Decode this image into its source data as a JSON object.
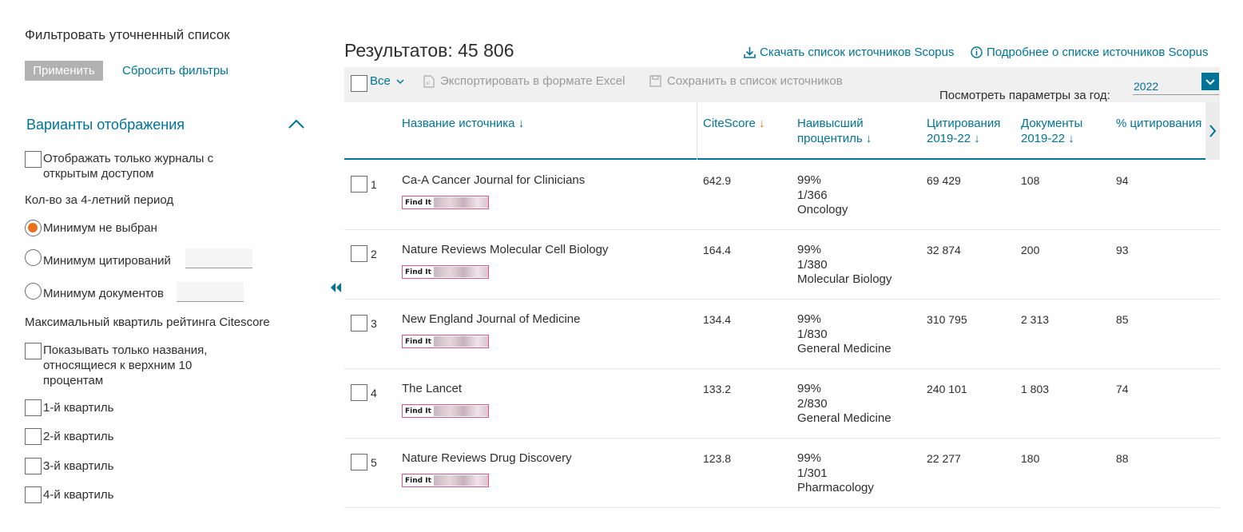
{
  "sidebar": {
    "title": "Фильтровать уточненный список",
    "apply_label": "Применить",
    "reset_label": "Сбросить фильтры",
    "display_options": "Варианты отображения",
    "open_access_label_1": "Отображать только журналы с",
    "open_access_label_2": "открытым доступом",
    "period_label": "Кол-во за 4-летний период",
    "min_not_selected": "Минимум не выбран",
    "min_citations": "Минимум цитирований",
    "min_documents": "Минимум документов",
    "quartile_heading": "Максимальный квартиль рейтинга Citescore",
    "top10_line1": "Показывать только названия,",
    "top10_line2": "относящиеся к верхним 10",
    "top10_line3": "процентам",
    "q1": "1-й квартиль",
    "q2": "2-й квартиль",
    "q3": "3-й квартиль",
    "q4": "4-й квартиль"
  },
  "main": {
    "results_label": "Результатов: 45 806",
    "download_label": "Скачать список источников Scopus",
    "more_info_label": "Подробнее о списке источников Scopus",
    "select_all_label": "Все",
    "export_label": "Экспортировать в формате Excel",
    "save_label": "Сохранить в список источников",
    "year_param_label": "Посмотреть параметры за год:",
    "year_value": "2022"
  },
  "table": {
    "headers": {
      "source": "Название источника",
      "citescore": "CiteScore",
      "percentile_1": "Наивысший",
      "percentile_2": "процентиль",
      "citations_1": "Цитирования",
      "citations_2": "2019-22",
      "documents_1": "Документы",
      "documents_2": "2019-22",
      "pct_cited": "% цитирования"
    },
    "findit_label": "Find It",
    "rows": [
      {
        "num": "1",
        "title": "Ca-A Cancer Journal for Clinicians",
        "citescore": "642.9",
        "pct": "99%",
        "rank": "1/366",
        "area": "Oncology",
        "citations": "69 429",
        "documents": "108",
        "cited": "94"
      },
      {
        "num": "2",
        "title": "Nature Reviews Molecular Cell Biology",
        "citescore": "164.4",
        "pct": "99%",
        "rank": "1/380",
        "area": "Molecular Biology",
        "citations": "32 874",
        "documents": "200",
        "cited": "93"
      },
      {
        "num": "3",
        "title": "New England Journal of Medicine",
        "citescore": "134.4",
        "pct": "99%",
        "rank": "1/830",
        "area": "General Medicine",
        "citations": "310 795",
        "documents": "2 313",
        "cited": "85"
      },
      {
        "num": "4",
        "title": "The Lancet",
        "citescore": "133.2",
        "pct": "99%",
        "rank": "2/830",
        "area": "General Medicine",
        "citations": "240 101",
        "documents": "1 803",
        "cited": "74"
      },
      {
        "num": "5",
        "title": "Nature Reviews Drug Discovery",
        "citescore": "123.8",
        "pct": "99%",
        "rank": "1/301",
        "area": "Pharmacology",
        "citations": "22 277",
        "documents": "180",
        "cited": "88"
      }
    ]
  },
  "colors": {
    "link": "#007398",
    "accent_orange": "#e9711c",
    "button_grey": "#b2b2b2"
  }
}
